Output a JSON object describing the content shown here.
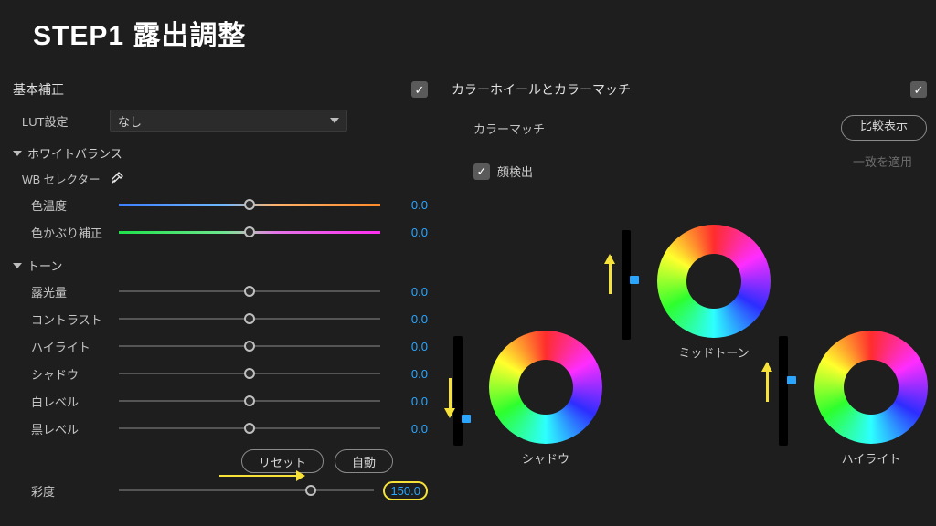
{
  "title": "STEP1 露出調整",
  "basic": {
    "heading": "基本補正",
    "enabled": true,
    "lut": {
      "label": "LUT設定",
      "value": "なし"
    },
    "wb": {
      "heading": "ホワイトバランス",
      "selector_label": "WB セレクター",
      "sliders": [
        {
          "label": "色温度",
          "value": "0.0",
          "pos": 50,
          "style": "temp"
        },
        {
          "label": "色かぶり補正",
          "value": "0.0",
          "pos": 50,
          "style": "tint"
        }
      ]
    },
    "tone": {
      "heading": "トーン",
      "sliders": [
        {
          "label": "露光量",
          "value": "0.0",
          "pos": 50
        },
        {
          "label": "コントラスト",
          "value": "0.0",
          "pos": 50
        },
        {
          "label": "ハイライト",
          "value": "0.0",
          "pos": 50
        },
        {
          "label": "シャドウ",
          "value": "0.0",
          "pos": 50
        },
        {
          "label": "白レベル",
          "value": "0.0",
          "pos": 50
        },
        {
          "label": "黒レベル",
          "value": "0.0",
          "pos": 50
        }
      ],
      "reset": "リセット",
      "auto": "自動"
    },
    "saturation": {
      "label": "彩度",
      "value": "150.0",
      "pos": 75
    }
  },
  "wheels": {
    "heading": "カラーホイールとカラーマッチ",
    "enabled": true,
    "match_label": "カラーマッチ",
    "compare_btn": "比較表示",
    "apply_btn": "一致を適用",
    "face_label": "顔検出",
    "face_checked": true,
    "shadow": {
      "label": "シャドウ"
    },
    "midtone": {
      "label": "ミッドトーン"
    },
    "highlight": {
      "label": "ハイライト"
    }
  }
}
